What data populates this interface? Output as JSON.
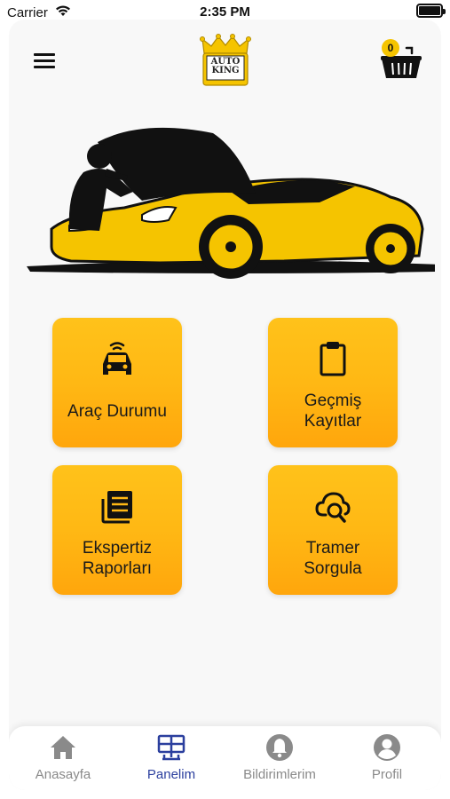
{
  "status_bar": {
    "carrier": "Carrier",
    "time": "2:35 PM"
  },
  "header": {
    "logo_text_line1": "AUTO",
    "logo_text_line2": "KING",
    "cart_count": "0"
  },
  "tiles": [
    {
      "label": "Araç Durumu",
      "icon": "car-wifi-icon"
    },
    {
      "label_line1": "Geçmiş",
      "label_line2": "Kayıtlar",
      "icon": "clipboard-icon"
    },
    {
      "label_line1": "Ekspertiz",
      "label_line2": "Raporları",
      "icon": "document-list-icon"
    },
    {
      "label_line1": "Tramer",
      "label_line2": "Sorgula",
      "icon": "cloud-search-icon"
    }
  ],
  "tabbar": {
    "active": "Panelim",
    "items": [
      {
        "label": "Anasayfa",
        "icon": "home-icon"
      },
      {
        "label": "Panelim",
        "icon": "dashboard-icon"
      },
      {
        "label": "Bildirimlerim",
        "icon": "bell-icon"
      },
      {
        "label": "Profil",
        "icon": "user-icon"
      }
    ]
  },
  "colors": {
    "accent": "#ffb814",
    "active_tab": "#2b3f9e",
    "inactive_tab": "#8a8a8a"
  }
}
